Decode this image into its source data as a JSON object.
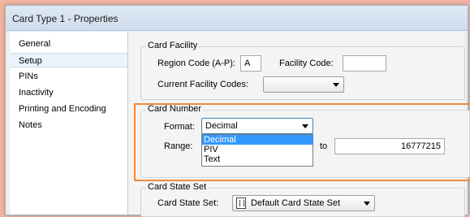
{
  "window": {
    "title": "Card Type 1 - Properties"
  },
  "nav": {
    "items": [
      {
        "label": "General"
      },
      {
        "label": "Setup"
      },
      {
        "label": "PINs"
      },
      {
        "label": "Inactivity"
      },
      {
        "label": "Printing and Encoding"
      },
      {
        "label": "Notes"
      }
    ],
    "selected": "Setup"
  },
  "card_facility": {
    "title": "Card Facility",
    "region_label": "Region Code (A-P):",
    "region_value": "A",
    "facility_label": "Facility Code:",
    "facility_value": "",
    "current_label": "Current Facility Codes:",
    "current_value": ""
  },
  "card_number": {
    "title": "Card Number",
    "format_label": "Format:",
    "format_value": "Decimal",
    "format_options": [
      "Decimal",
      "PIV",
      "Text"
    ],
    "range_label": "Range:",
    "to_label": "to",
    "range_to_value": "16777215"
  },
  "card_state_set": {
    "title": "Card State Set",
    "label": "Card State Set:",
    "value": "Default Card State Set",
    "icon": "card-state-icon"
  }
}
